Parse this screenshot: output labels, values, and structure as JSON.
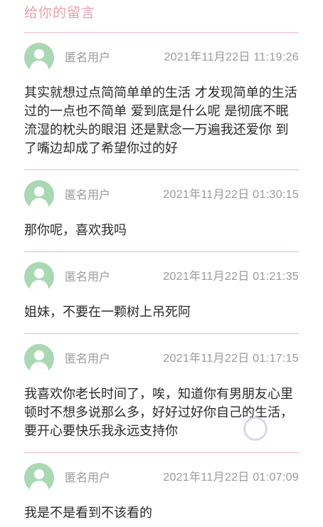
{
  "header": {
    "title": "给你的留言"
  },
  "messages": [
    {
      "user": "匿名用户",
      "time": "2021年11月22日 11:19:26",
      "text": "其实就想过点简简单单的生活 才发现简单的生活过的一点也不简单  爱到底是什么呢 是彻底不眠流湿的枕头的眼泪 还是默念一万遍我还爱你 到了嘴边却成了希望你过的好"
    },
    {
      "user": "匿名用户",
      "time": "2021年11月22日 01:30:15",
      "text": "那你呢，喜欢我吗"
    },
    {
      "user": "匿名用户",
      "time": "2021年11月22日 01:21:35",
      "text": "姐妹，不要在一颗树上吊死阿"
    },
    {
      "user": "匿名用户",
      "time": "2021年11月22日 01:17:15",
      "text": "我喜欢你老长时间了，唉，知道你有男朋友心里顿时不想多说那么多，好好过好你自己的生活，要开心要快乐我永远支持你"
    },
    {
      "user": "匿名用户",
      "time": "2021年11月22日 01:07:09",
      "text": "我是不是看到不该看的"
    }
  ],
  "icons": {
    "avatar": "user-avatar-icon"
  },
  "colors": {
    "accent": "#e8a0ae",
    "avatar": "#a9d8b3",
    "divider": "#f0b8c2",
    "meta": "#9a9a9a"
  }
}
